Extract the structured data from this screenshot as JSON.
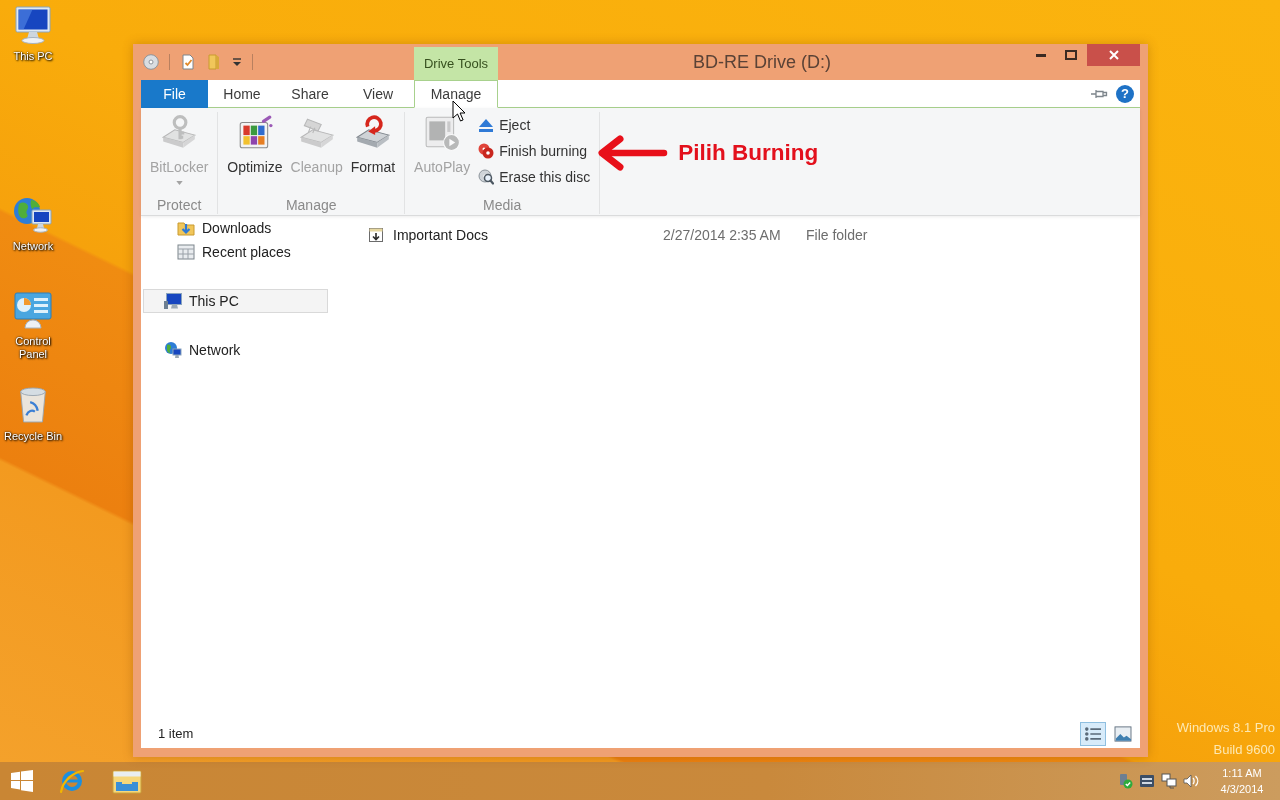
{
  "desktop": {
    "icons": [
      {
        "label": "This PC",
        "kind": "computer"
      },
      {
        "label": "Network",
        "kind": "network"
      },
      {
        "label": "Control Panel",
        "kind": "panel"
      },
      {
        "label": "Recycle Bin",
        "kind": "bin"
      }
    ],
    "edition": [
      "Windows 8.1 Pro",
      "Build 9600"
    ]
  },
  "window": {
    "title": "BD-RE Drive (D:)",
    "context_header": "Drive Tools",
    "tabs": [
      {
        "label": "File",
        "kind": "backstage",
        "selected": false
      },
      {
        "label": "Home",
        "kind": "tab",
        "selected": false
      },
      {
        "label": "Share",
        "kind": "tab",
        "selected": false
      },
      {
        "label": "View",
        "kind": "tab",
        "selected": false
      },
      {
        "label": "Manage",
        "kind": "contextual",
        "selected": true
      }
    ],
    "help": "?",
    "ribbon": [
      {
        "label": "Protect",
        "large": [
          {
            "label": "BitLocker",
            "kind": "lock",
            "disabled": true,
            "dropdown": true
          }
        ]
      },
      {
        "label": "Manage",
        "large": [
          {
            "label": "Optimize",
            "kind": "defrag",
            "disabled": false,
            "dropdown": false
          },
          {
            "label": "Cleanup",
            "kind": "cleanup",
            "disabled": true,
            "dropdown": false
          },
          {
            "label": "Format",
            "kind": "format",
            "disabled": false,
            "dropdown": false
          }
        ]
      },
      {
        "label": "Media",
        "large": [
          {
            "label": "AutoPlay",
            "kind": "autoplay",
            "disabled": true,
            "dropdown": false
          }
        ],
        "small": [
          {
            "label": "Eject",
            "kind": "eject",
            "disabled": false
          },
          {
            "label": "Finish burning",
            "kind": "burn",
            "disabled": false
          },
          {
            "label": "Erase this disc",
            "kind": "erase",
            "disabled": false
          }
        ]
      }
    ],
    "annotation": "Pilih Burning",
    "navigation": [
      {
        "children": [
          {
            "label": "Downloads",
            "kind": "downloads",
            "selected": false
          },
          {
            "label": "Recent places",
            "kind": "recent",
            "selected": false
          }
        ]
      },
      {
        "label": "This PC",
        "kind": "computer",
        "selected": true
      },
      {
        "label": "Network",
        "kind": "network",
        "selected": false
      }
    ],
    "files": [
      {
        "cells": [
          "Important Docs",
          "2/27/2014 2:35 AM",
          "File folder"
        ]
      }
    ],
    "status_bar": {
      "text": "1 item",
      "views": [
        {
          "kind": "details",
          "selected": true
        },
        {
          "kind": "icons",
          "selected": false
        }
      ]
    }
  },
  "taskbar": {
    "time": "1:11 AM",
    "date": "4/3/2014"
  }
}
